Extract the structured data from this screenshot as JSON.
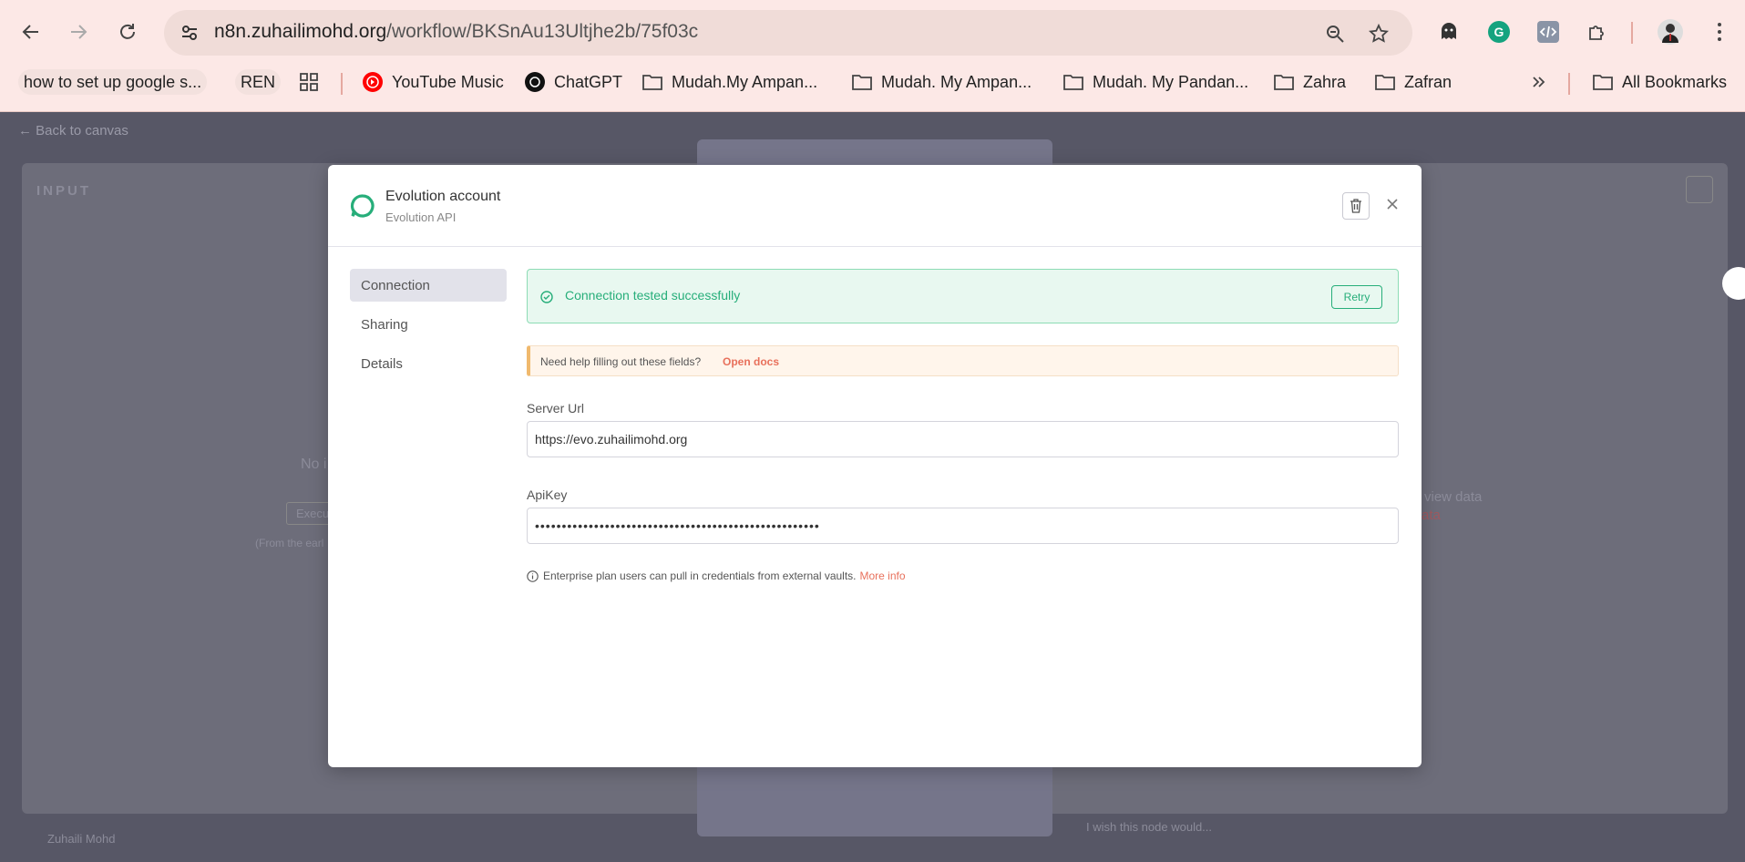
{
  "browser": {
    "url_host": "n8n.zuhailimohd.org",
    "url_path": "/workflow/BKSnAu13Ultjhe2b/75f03c",
    "bookmarks": [
      {
        "label": "how to set up google s...",
        "type": "chip"
      },
      {
        "label": "REN",
        "type": "chip"
      },
      {
        "label": "YouTube Music",
        "type": "youtube-music-icon"
      },
      {
        "label": "ChatGPT",
        "type": "chatgpt-icon"
      },
      {
        "label": "Mudah.My Ampan...",
        "type": "folder"
      },
      {
        "label": "Mudah. My Ampan...",
        "type": "folder"
      },
      {
        "label": "Mudah. My Pandan...",
        "type": "folder"
      },
      {
        "label": "Zahra",
        "type": "folder"
      },
      {
        "label": "Zafran",
        "type": "folder"
      }
    ],
    "all_bookmarks": "All Bookmarks"
  },
  "background": {
    "back_link": "Back to canvas",
    "input_label": "INPUT",
    "no_input_text": "No i",
    "execute_text": "Execu",
    "from_earlier_text": "(From the earl",
    "view_data_text": "view data",
    "data_text": "ata",
    "footer_user": "Zuhaili Mohd",
    "wish_text": "I wish this node would..."
  },
  "modal": {
    "title": "Evolution account",
    "subtitle": "Evolution API",
    "nav": [
      "Connection",
      "Sharing",
      "Details"
    ],
    "success_message": "Connection tested successfully",
    "retry_label": "Retry",
    "help_text": "Need help filling out these fields?",
    "help_link": "Open docs",
    "server_url_label": "Server Url",
    "server_url_value": "https://evo.zuhailimohd.org",
    "apikey_label": "ApiKey",
    "apikey_value": "•••••••••••••••••••••••••••••••••••••••••••••••••••••",
    "enterprise_text": "Enterprise plan users can pull in credentials from external vaults.",
    "more_info": "More info"
  },
  "colors": {
    "success": "#27ae7a",
    "accent": "#e8705b",
    "chrome_bg": "#fce8e6"
  }
}
